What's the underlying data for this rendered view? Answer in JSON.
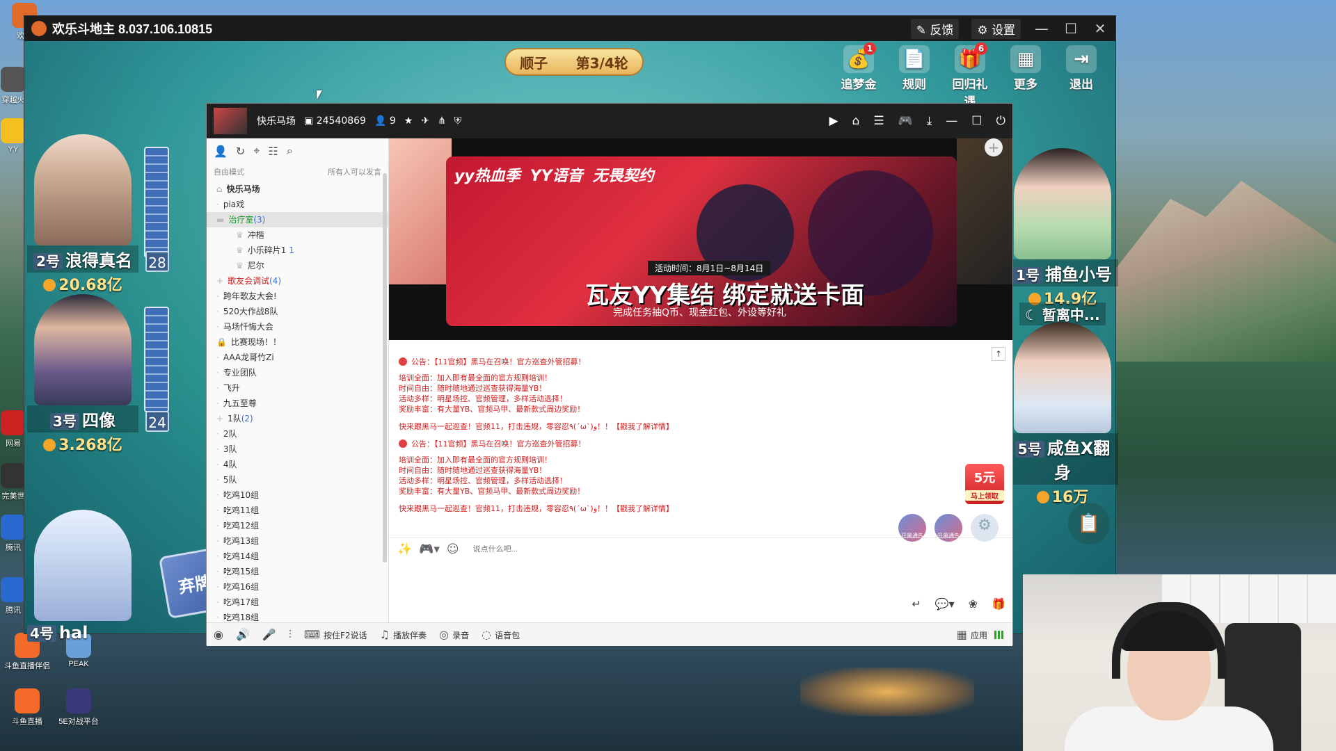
{
  "desktop": {
    "icons": [
      {
        "label": "欢乐"
      },
      {
        "label": "穿越火"
      },
      {
        "label": "YY"
      },
      {
        "label": "网易"
      },
      {
        "label": "完美世"
      },
      {
        "label": "腾讯"
      },
      {
        "label": "腾讯"
      },
      {
        "label": "斗鱼直播伴侣"
      },
      {
        "label": "PEAK"
      },
      {
        "label": "斗鱼直播"
      },
      {
        "label": "5E对战平台"
      }
    ]
  },
  "game": {
    "title": "欢乐斗地主 8.037.106.10815",
    "feedback": "反馈",
    "settings": "设置",
    "round": {
      "type": "顺子",
      "progress": "第3/4轮"
    },
    "top_actions": [
      {
        "label": "追梦金",
        "badge": "1"
      },
      {
        "label": "规则",
        "badge": ""
      },
      {
        "label": "回归礼遇",
        "badge": "6"
      },
      {
        "label": "更多",
        "badge": ""
      },
      {
        "label": "退出",
        "badge": ""
      }
    ],
    "players": {
      "p2": {
        "seat": "2号",
        "name": "浪得真名",
        "coins": "20.68亿",
        "cards": "28"
      },
      "p3": {
        "seat": "3号",
        "name": "四像",
        "coins": "3.268亿",
        "cards": "24"
      },
      "p4": {
        "seat": "4号",
        "name": "hal"
      },
      "p1": {
        "seat": "1号",
        "name": "捕鱼小号",
        "coins": "14.9亿"
      },
      "p5": {
        "seat": "5号",
        "name": "咸鱼X翻身",
        "coins": "16万"
      }
    },
    "away_status": "暂离中...",
    "discard_label": "弃牌"
  },
  "yy": {
    "channel_name": "快乐马场",
    "channel_id": "24540869",
    "online_count": "9",
    "mode": "自由模式",
    "speak_policy": "所有人可以发言",
    "tree": {
      "root": "快乐马场",
      "items": [
        {
          "label": "pia戏",
          "count": ""
        },
        {
          "label": "治疗室",
          "count": "(3)"
        }
      ],
      "members": [
        {
          "name": "冲楷",
          "extra": ""
        },
        {
          "name": "小乐碎片1",
          "extra": "1"
        },
        {
          "name": "尼尔",
          "extra": ""
        }
      ],
      "rooms": [
        {
          "label": "歌友会调试",
          "count": "(4)"
        },
        {
          "label": "跨年歌友大会!",
          "count": ""
        },
        {
          "label": "520大作战8队",
          "count": ""
        },
        {
          "label": "马场忏悔大会",
          "count": ""
        },
        {
          "label": "比赛现场！！",
          "count": ""
        },
        {
          "label": "AAA龙哥竹Zi",
          "count": ""
        },
        {
          "label": "专业团队",
          "count": ""
        },
        {
          "label": "飞升",
          "count": ""
        },
        {
          "label": "九五至尊",
          "count": ""
        },
        {
          "label": "1队",
          "count": "(2)"
        },
        {
          "label": "2队",
          "count": ""
        },
        {
          "label": "3队",
          "count": ""
        },
        {
          "label": "4队",
          "count": ""
        },
        {
          "label": "5队",
          "count": ""
        },
        {
          "label": "吃鸡10组",
          "count": ""
        },
        {
          "label": "吃鸡11组",
          "count": ""
        },
        {
          "label": "吃鸡12组",
          "count": ""
        },
        {
          "label": "吃鸡13组",
          "count": ""
        },
        {
          "label": "吃鸡14组",
          "count": ""
        },
        {
          "label": "吃鸡15组",
          "count": ""
        },
        {
          "label": "吃鸡16组",
          "count": ""
        },
        {
          "label": "吃鸡17组",
          "count": ""
        },
        {
          "label": "吃鸡18组",
          "count": ""
        }
      ]
    },
    "banner": {
      "brand1": "yy热血季",
      "brand2": "YY语音",
      "brand3": "无畏契约",
      "period": "活动时间：8月1日~8月14日",
      "headline": "瓦友YY集结 绑定就送卡面",
      "subline": "完成任务抽Q币、现金红包、外设等好礼"
    },
    "chat": {
      "notices": [
        {
          "title": "公告：【11官频】黑马在召唤！官方巡查外管招募！",
          "lines": [
            "培训全面：加入即有最全面的官方规则培训！",
            "时间自由：随时随地通过巡查获得海量YB！",
            "活动多样：明星场控、官频管理，多样活动选择！",
            "奖励丰富：有大量YB、官频马甲、最新款式周边奖励！"
          ],
          "cta": "快来跟黑马一起巡查！官频11，打击违规，零容忍٩(ˊωˋ)و！！【戳我了解详情】"
        },
        {
          "title": "公告：【11官频】黑马在召唤！官方巡查外管招募！",
          "lines": [
            "培训全面：加入即有最全面的官方规则培训！",
            "时间自由：随时随地通过巡查获得海量YB！",
            "活动多样：明星场控、官频管理，多样活动选择！",
            "奖励丰富：有大量YB、官频马甲、最新款式周边奖励！"
          ],
          "cta": "快来跟黑马一起巡查！官频11，打击违规，零容忍٩(ˊωˋ)و！！【戳我了解详情】"
        }
      ],
      "input_placeholder": "说点什么吧..."
    },
    "redpacket": {
      "amount": "5元",
      "label": "马上领取"
    },
    "gift_labels": [
      "开黑通告",
      "开黑通告"
    ],
    "footer": {
      "f2_talk": "按住F2说话",
      "accompany": "播放伴奏",
      "record": "录音",
      "voice_pack": "语音包",
      "apps": "应用"
    }
  }
}
